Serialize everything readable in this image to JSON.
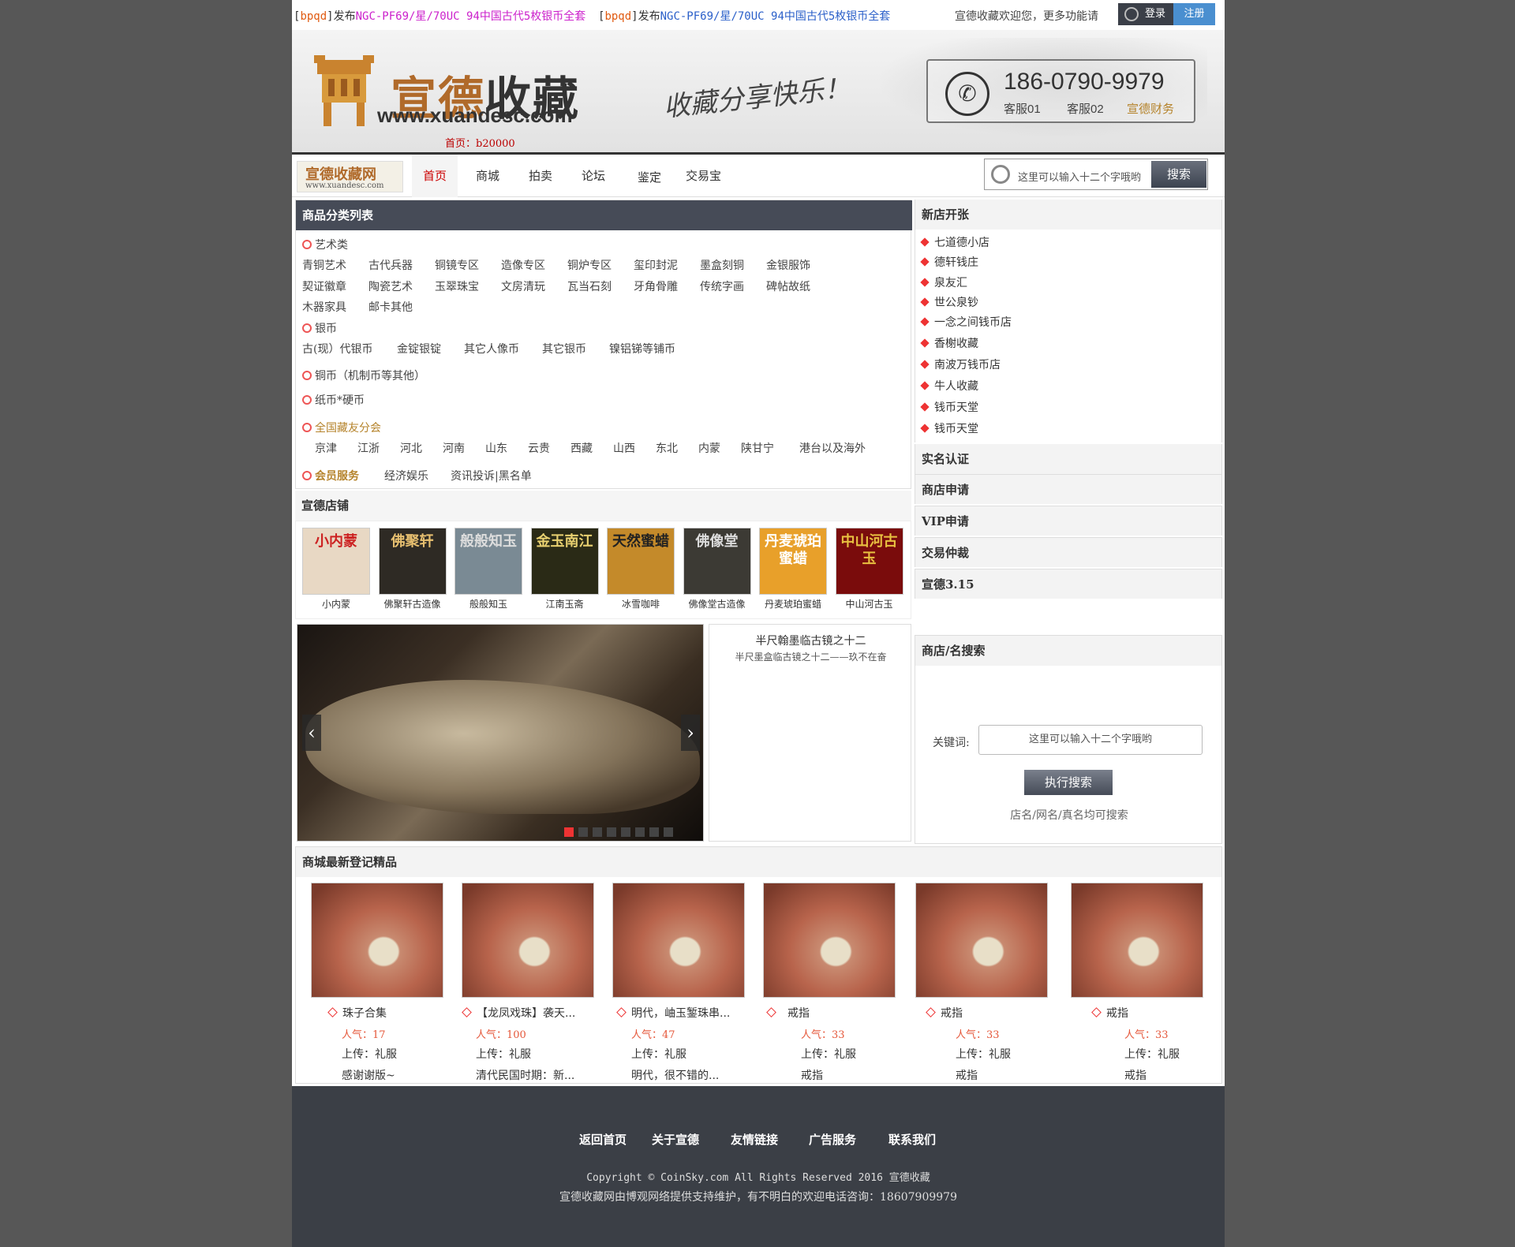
{
  "ticker": [
    {
      "bracket_open": "[",
      "author": "bpqd",
      "bracket_close": "]",
      "verb": "发布",
      "title": "NGC-PF69/星/70UC 94中国古代5枚银币全套"
    },
    {
      "bracket_open": "[",
      "author": "bpqd",
      "bracket_close": "]",
      "verb": "发布",
      "title": "NGC-PF69/星/70UC 94中国古代5枚银币全套"
    }
  ],
  "welcome": "宣德收藏欢迎您，更多功能请",
  "login": "登录",
  "register": "注册",
  "banner": {
    "logo_a": "宣德",
    "logo_b": "收藏",
    "url": "www.xuandesc.com",
    "slogan": "收藏分享快乐！",
    "phone": "186-0790-9979",
    "kf1": "客服01",
    "kf2": "客服02",
    "kf3": "宣德财务",
    "home_label": "首页：b20000"
  },
  "nav": {
    "logo_a": "宣德收藏网",
    "logo_b": "www.xuandesc.com",
    "items": [
      "首页",
      "商城",
      "拍卖",
      "论坛",
      "鉴定",
      "交易宝"
    ],
    "search_placeholder": "这里可以输入十二个字哦哟",
    "search_btn": "搜索"
  },
  "categories": {
    "title": "商品分类列表",
    "art": "艺术类",
    "art_row1": [
      "青铜艺术",
      "古代兵器",
      "铜镜专区",
      "造像专区",
      "铜炉专区",
      "玺印封泥",
      "墨盒刻铜",
      "金银服饰"
    ],
    "art_row2": [
      "契证徽章",
      "陶瓷艺术",
      "玉翠珠宝",
      "文房清玩",
      "瓦当石刻",
      "牙角骨雕",
      "传统字画",
      "碑帖故纸"
    ],
    "art_row3": [
      "木器家具",
      "邮卡其他"
    ],
    "silver": "银币",
    "silver_row": [
      "古(现）代银币",
      "金锭银锭",
      "其它人像币",
      "其它银币",
      "镍铝锑等铺币"
    ],
    "copper": "铜币（机制币等其他）",
    "paper": "纸币*硬币",
    "branch": "全国藏友分会",
    "branch_row": [
      "京津",
      "江浙",
      "河北",
      "河南",
      "山东",
      "云贵",
      "西藏",
      "山西",
      "东北",
      "内蒙",
      "陕甘宁",
      "港台以及海外"
    ],
    "member": "会员服务",
    "member_row": [
      "经济娱乐",
      "资讯投诉|黑名单"
    ]
  },
  "shops": {
    "title": "宣德店铺",
    "items": [
      "小内蒙",
      "佛聚轩古造像",
      "般般知玉",
      "江南玉斋",
      "冰雪咖啡",
      "佛像堂古造像",
      "丹麦琥珀蜜蜡",
      "中山河古玉"
    ],
    "img_text": [
      "小内蒙",
      "佛聚轩",
      "般般知玉",
      "金玉南江",
      "天然蜜蜡",
      "佛像堂",
      "丹麦琥珀蜜蜡",
      "中山河古玉"
    ]
  },
  "slider": {
    "caption_title": "半尺翰墨临古镜之十二",
    "caption_sub": "半尺墨盒临古镜之十二——玖不在奋",
    "dots": 8,
    "active_dot": 0
  },
  "right": {
    "newshops_title": "新店开张",
    "newshops": [
      "七道德小店",
      "德轩钱庄",
      "泉友汇",
      "世公泉钞",
      "一念之间钱币店",
      "香榭收藏",
      "南波万钱币店",
      "牛人收藏",
      "钱币天堂",
      "钱币天堂"
    ],
    "links": [
      "实名认证",
      "商店申请",
      "VIP申请",
      "交易仲裁",
      "宣德3.15"
    ],
    "search_title": "商店/名搜索",
    "kw_label": "关键词:",
    "kw_placeholder": "这里可以输入十二个字哦哟",
    "exec_btn": "执行搜索",
    "hint": "店名/网名/真名均可搜索"
  },
  "products": {
    "title": "商城最新登记精品",
    "items": [
      {
        "name": "珠子合集",
        "hot": "人气：17",
        "upload": "上传：礼服",
        "desc": "感谢谢版~"
      },
      {
        "name": "【龙凤戏珠】袭天...",
        "hot": "人气：100",
        "upload": "上传：礼服",
        "desc": "清代民国时期：新..."
      },
      {
        "name": "明代，岫玉錾珠串...",
        "hot": "人气：47",
        "upload": "上传：礼服",
        "desc": "明代，很不错的..."
      },
      {
        "name": "戒指",
        "hot": "人气：33",
        "upload": "上传：礼服",
        "desc": "戒指"
      },
      {
        "name": "戒指",
        "hot": "人气：33",
        "upload": "上传：礼服",
        "desc": "戒指"
      },
      {
        "name": "戒指",
        "hot": "人气：33",
        "upload": "上传：礼服",
        "desc": "戒指"
      }
    ]
  },
  "footer": {
    "links": [
      "返回首页",
      "关于宣德",
      "友情链接",
      "广告服务",
      "联系我们"
    ],
    "copyright": "Copyright © CoinSky.com All Rights Reserved 2016 宣德收藏",
    "support": "宣德收藏网由博观网络提供支持维护，有不明白的欢迎电话咨询：18607909979"
  }
}
